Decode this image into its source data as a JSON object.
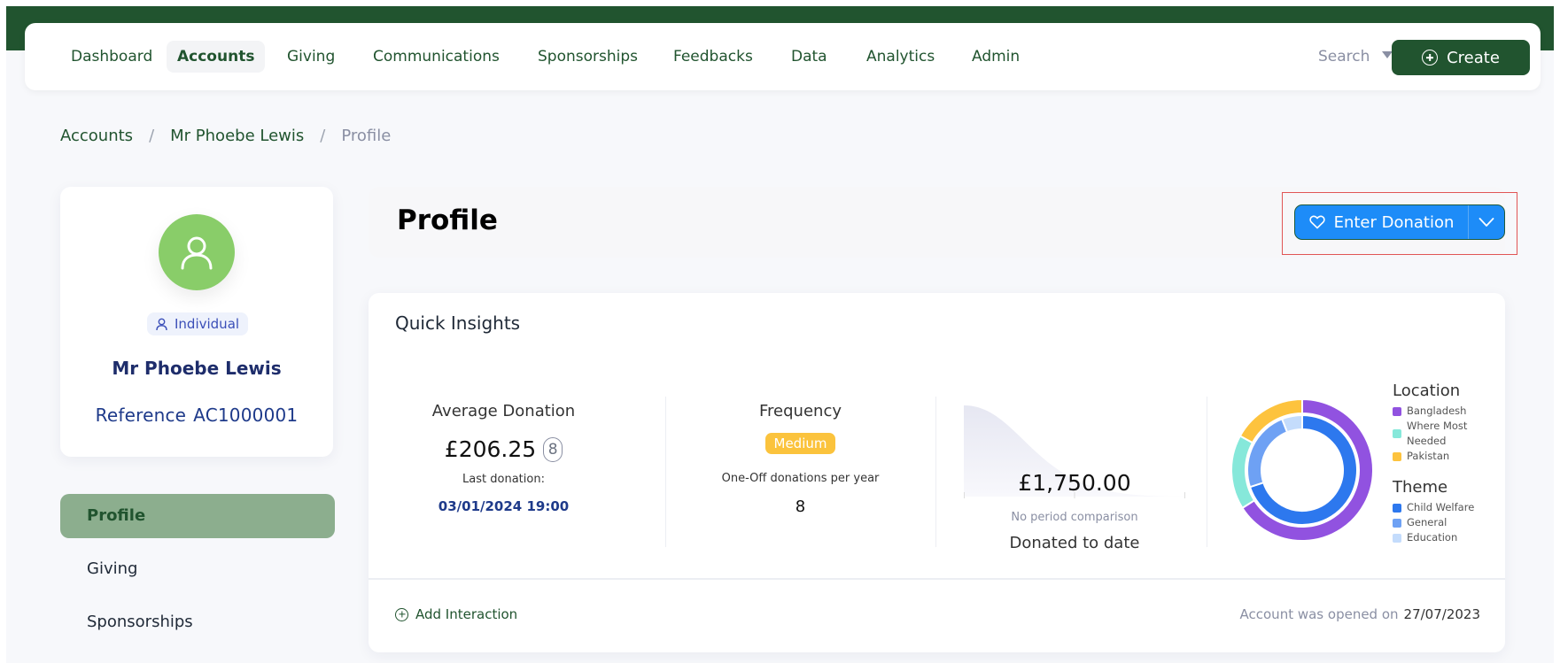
{
  "nav": {
    "items": [
      {
        "label": "Dashboard",
        "active": false
      },
      {
        "label": "Accounts",
        "active": true
      },
      {
        "label": "Giving",
        "active": false
      },
      {
        "label": "Communications",
        "active": false
      },
      {
        "label": "Sponsorships",
        "active": false
      },
      {
        "label": "Feedbacks",
        "active": false
      },
      {
        "label": "Data",
        "active": false
      },
      {
        "label": "Analytics",
        "active": false
      },
      {
        "label": "Admin",
        "active": false
      }
    ],
    "search_label": "Search",
    "create_label": "Create"
  },
  "breadcrumb": {
    "items": [
      "Accounts",
      "Mr Phoebe Lewis",
      "Profile"
    ],
    "separator": "/"
  },
  "profile": {
    "type_badge": "Individual",
    "name": "Mr Phoebe Lewis",
    "reference_label": "Reference",
    "reference_value": "AC1000001"
  },
  "side_menu": {
    "items": [
      {
        "label": "Profile",
        "active": true
      },
      {
        "label": "Giving",
        "active": false
      },
      {
        "label": "Sponsorships",
        "active": false
      }
    ]
  },
  "header": {
    "title": "Profile",
    "enter_donation_label": "Enter Donation"
  },
  "insights": {
    "title": "Quick Insights",
    "average": {
      "label": "Average Donation",
      "value": "£206.25",
      "count": "8",
      "last_label": "Last donation:",
      "last_date": "03/01/2024 19:00"
    },
    "frequency": {
      "label": "Frequency",
      "badge": "Medium",
      "sub_label": "One-Off donations per year",
      "value": "8"
    },
    "total": {
      "value": "£1,750.00",
      "comparison": "No period comparison",
      "label": "Donated to date"
    },
    "footer": {
      "add_interaction": "Add Interaction",
      "opened_label": "Account was opened on",
      "opened_date": "27/07/2023"
    }
  },
  "chart_data": {
    "type": "pie",
    "title": "",
    "rings": [
      {
        "name": "Location",
        "ring": "outer",
        "slices": [
          {
            "label": "Bangladesh",
            "value": 66,
            "color": "#9152e0"
          },
          {
            "label": "Where Most Needed",
            "value": 17,
            "color": "#86e8da"
          },
          {
            "label": "Pakistan",
            "value": 17,
            "color": "#fdc33e"
          }
        ]
      },
      {
        "name": "Theme",
        "ring": "inner",
        "slices": [
          {
            "label": "Child Welfare",
            "value": 70,
            "color": "#2d78ee"
          },
          {
            "label": "General",
            "value": 24,
            "color": "#6ea1f4"
          },
          {
            "label": "Education",
            "value": 6,
            "color": "#c4dcfc"
          }
        ]
      }
    ],
    "legend_position": "right"
  },
  "colors": {
    "brand_green": "#21542f",
    "donate_blue": "#1d8cf8",
    "badge_yellow": "#fbc33d",
    "avatar_green": "#89cd69",
    "side_active": "#8cae8e"
  }
}
